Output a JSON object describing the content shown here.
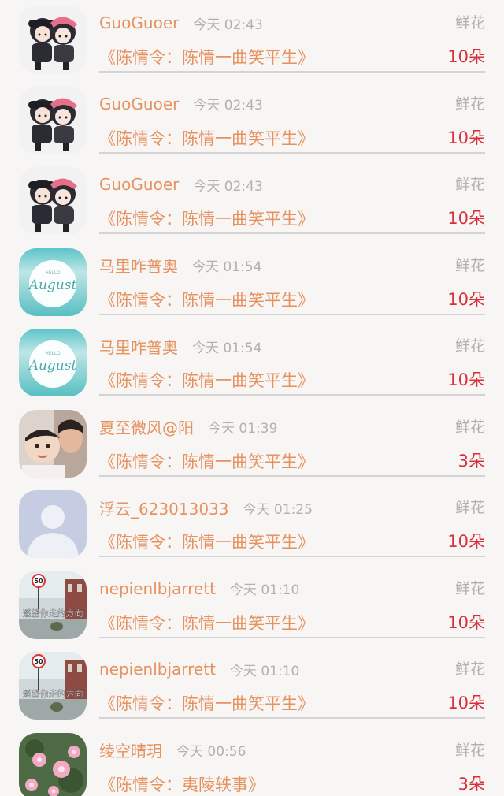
{
  "rows": [
    {
      "user": "GuoGuoer",
      "time": "今天 02:43",
      "gift": "鲜花",
      "book": "《陈情令：陈情一曲笑平生》",
      "amount": "10朵",
      "avatar": "anime-couple"
    },
    {
      "user": "GuoGuoer",
      "time": "今天 02:43",
      "gift": "鲜花",
      "book": "《陈情令：陈情一曲笑平生》",
      "amount": "10朵",
      "avatar": "anime-couple"
    },
    {
      "user": "GuoGuoer",
      "time": "今天 02:43",
      "gift": "鲜花",
      "book": "《陈情令：陈情一曲笑平生》",
      "amount": "10朵",
      "avatar": "anime-couple"
    },
    {
      "user": "马里咋普奥",
      "time": "今天 01:54",
      "gift": "鲜花",
      "book": "《陈情令：陈情一曲笑平生》",
      "amount": "10朵",
      "avatar": "hello-august",
      "avatar_text": "August",
      "avatar_small_text": "HELLO"
    },
    {
      "user": "马里咋普奥",
      "time": "今天 01:54",
      "gift": "鲜花",
      "book": "《陈情令：陈情一曲笑平生》",
      "amount": "10朵",
      "avatar": "hello-august",
      "avatar_text": "August",
      "avatar_small_text": "HELLO"
    },
    {
      "user": "夏至微风@阳",
      "time": "今天 01:39",
      "gift": "鲜花",
      "book": "《陈情令：陈情一曲笑平生》",
      "amount": "3朵",
      "avatar": "family-photo"
    },
    {
      "user": "浮云_623013033",
      "time": "今天 01:25",
      "gift": "鲜花",
      "book": "《陈情令：陈情一曲笑平生》",
      "amount": "10朵",
      "avatar": "default-person"
    },
    {
      "user": "nepienlbjarrett",
      "time": "今天 01:10",
      "gift": "鲜花",
      "book": "《陈情令：陈情一曲笑平生》",
      "amount": "10朵",
      "avatar": "street-photo",
      "avatar_text": "遥望你走的方向",
      "avatar_sign": "50"
    },
    {
      "user": "nepienlbjarrett",
      "time": "今天 01:10",
      "gift": "鲜花",
      "book": "《陈情令：陈情一曲笑平生》",
      "amount": "10朵",
      "avatar": "street-photo",
      "avatar_text": "遥望你走的方向",
      "avatar_sign": "50"
    },
    {
      "user": "绫空晴玥",
      "time": "今天 00:56",
      "gift": "鲜花",
      "book": "《陈情令：夷陵轶事》",
      "amount": "3朵",
      "avatar": "flowers-photo"
    }
  ],
  "colors": {
    "username": "#e5925f",
    "time": "#b3b0b0",
    "amount": "#d8303a",
    "background": "#f8f5f5"
  }
}
